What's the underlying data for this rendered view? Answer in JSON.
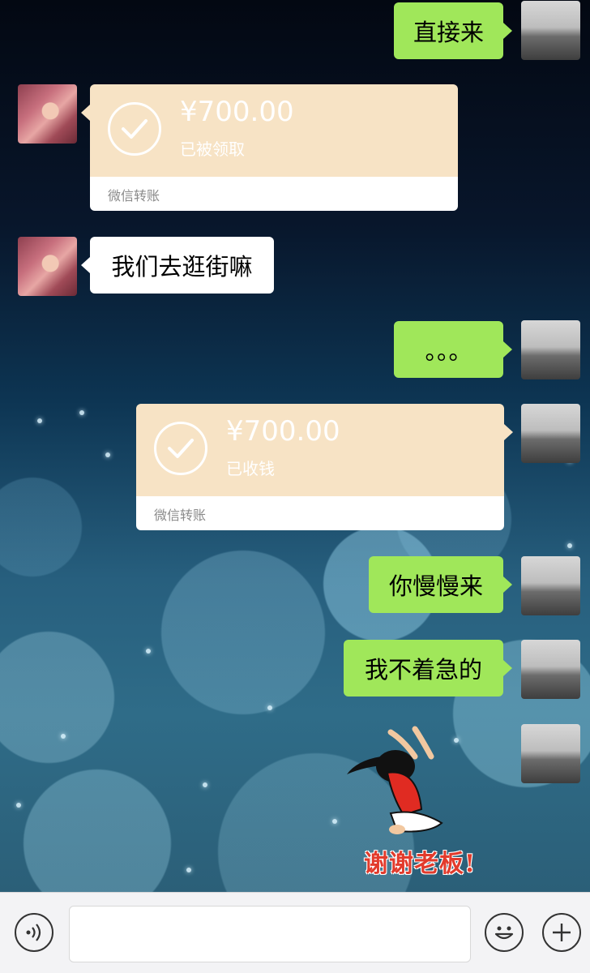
{
  "messages": [
    {
      "side": "right",
      "type": "text",
      "text": "直接来"
    },
    {
      "side": "left",
      "type": "transfer",
      "amount": "¥700.00",
      "status": "已被领取",
      "label": "微信转账"
    },
    {
      "side": "left",
      "type": "text",
      "text": "我们去逛街嘛"
    },
    {
      "side": "right",
      "type": "text",
      "text": "。。。"
    },
    {
      "side": "right",
      "type": "transfer",
      "amount": "¥700.00",
      "status": "已收钱",
      "label": "微信转账"
    },
    {
      "side": "right",
      "type": "text",
      "text": "你慢慢来"
    },
    {
      "side": "right",
      "type": "text",
      "text": "我不着急的"
    },
    {
      "side": "right",
      "type": "sticker",
      "text": "谢谢老板!"
    }
  ],
  "colors": {
    "my_bubble": "#a0e75a",
    "other_bubble": "#ffffff",
    "transfer_top": "#f7e3c5",
    "sticker_text": "#e23b2c"
  },
  "input_bar": {
    "voice_icon": "voice-icon",
    "emoji_icon": "emoji-icon",
    "plus_icon": "plus-icon",
    "text_value": ""
  }
}
